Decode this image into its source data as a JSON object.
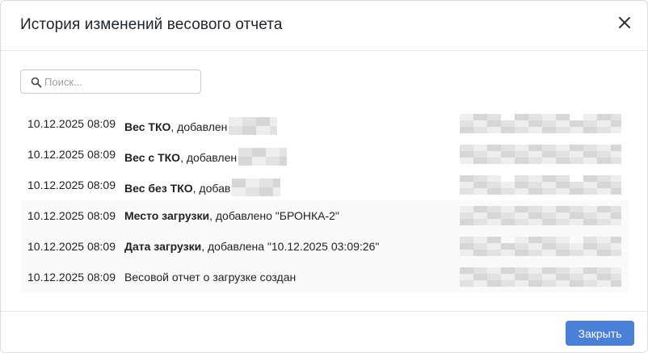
{
  "dialog": {
    "title": "История изменений весового отчета",
    "close_icon": "close-icon"
  },
  "search": {
    "placeholder": "Поиск...",
    "value": "",
    "icon": "search-icon"
  },
  "history": [
    {
      "date": "10.12.2025 08:09",
      "field": "Вес ТКО",
      "action": ", добавлен",
      "value_redacted": true
    },
    {
      "date": "10.12.2025 08:09",
      "field": "Вес с ТКО",
      "action": ", добавлен",
      "value_redacted": true
    },
    {
      "date": "10.12.2025 08:09",
      "field": "Вес без ТКО",
      "action": ", добав",
      "value_redacted": true
    },
    {
      "date": "10.12.2025 08:09",
      "field": "Место загрузки",
      "action": ", добавлено \"БРОНКА-2\"",
      "value_redacted": false
    },
    {
      "date": "10.12.2025 08:09",
      "field": "Дата загрузки",
      "action": ", добавлена \"10.12.2025 03:09:26\"",
      "value_redacted": false
    },
    {
      "date": "10.12.2025 08:09",
      "field": "",
      "action": "Весовой отчет о загрузке создан",
      "value_redacted": false
    }
  ],
  "footer": {
    "close_label": "Закрыть"
  },
  "colors": {
    "primary_button": "#4a7fd8",
    "redaction_light": "#eeeeee",
    "redaction_mid": "#e2e2e2",
    "redaction_dark": "#d6d6d6"
  }
}
